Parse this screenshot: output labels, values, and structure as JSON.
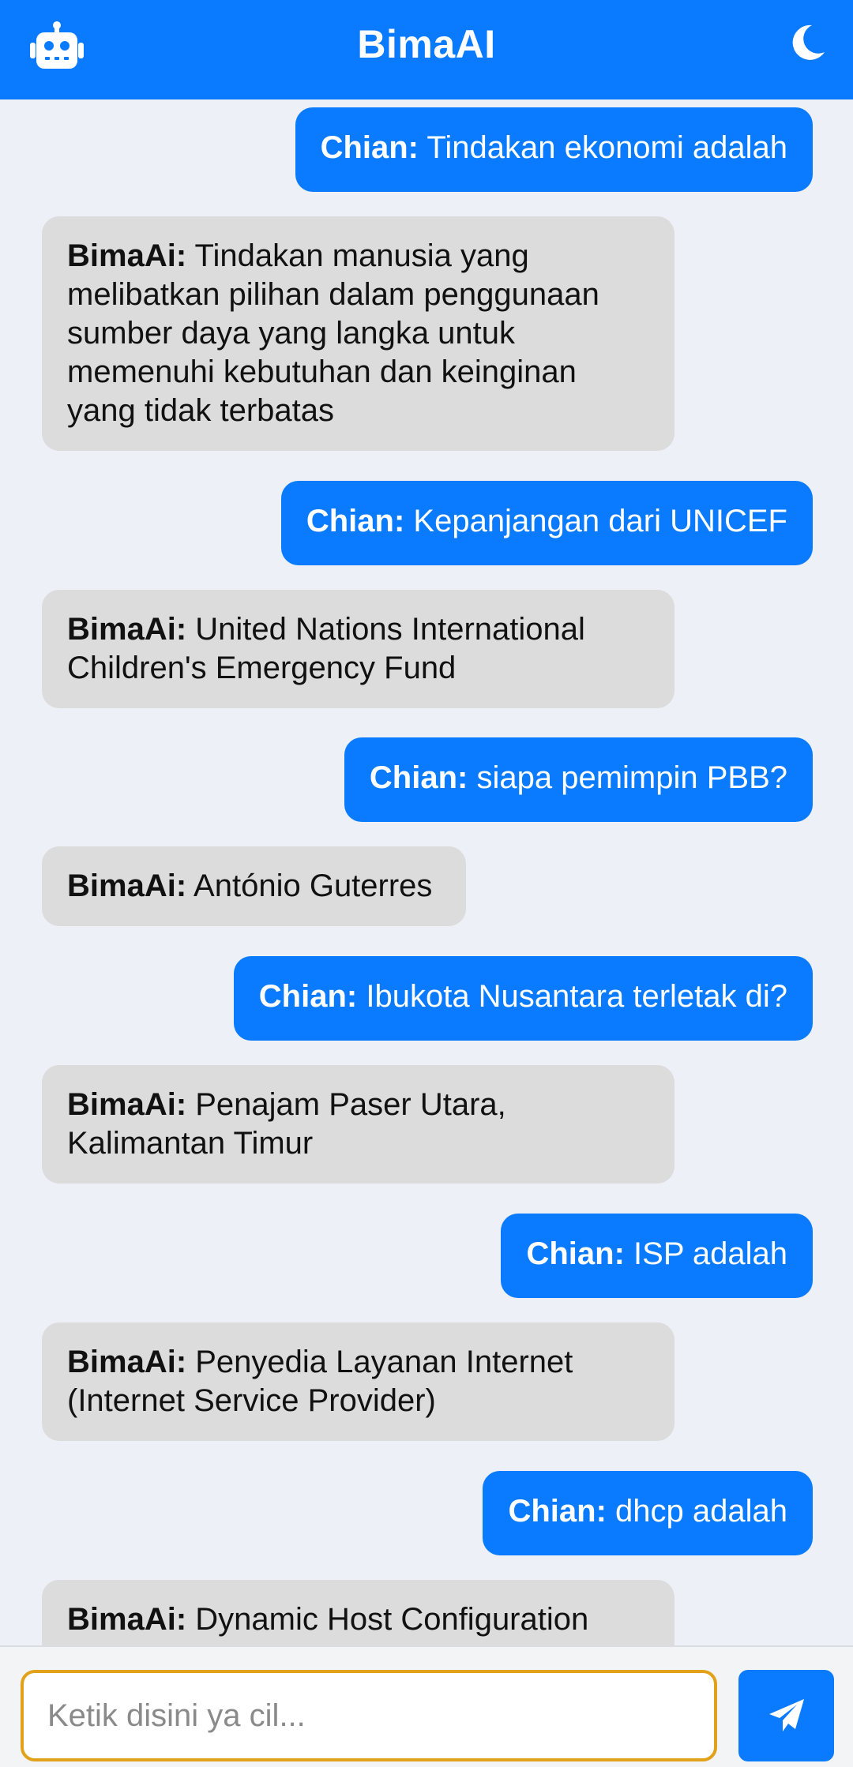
{
  "header": {
    "title": "BimaAI",
    "left_icon": "robot-icon",
    "right_icon": "moon-icon"
  },
  "messages": [
    {
      "role": "user",
      "sender": "Chian:",
      "text": " Tindakan ekonomi adalah"
    },
    {
      "role": "bot",
      "sender": "BimaAi:",
      "text": " Tindakan manusia yang melibatkan pilihan dalam penggunaan sumber daya yang langka untuk memenuhi kebutuhan dan keinginan yang tidak terbatas"
    },
    {
      "role": "user",
      "sender": "Chian:",
      "text": " Kepanjangan dari UNICEF"
    },
    {
      "role": "bot",
      "sender": "BimaAi:",
      "text": " United Nations International Children's Emergency Fund"
    },
    {
      "role": "user",
      "sender": "Chian:",
      "text": " siapa pemimpin PBB?"
    },
    {
      "role": "bot",
      "sender": "BimaAi:",
      "text": " António Guterres"
    },
    {
      "role": "user",
      "sender": "Chian:",
      "text": " Ibukota Nusantara terletak di?"
    },
    {
      "role": "bot",
      "sender": "BimaAi:",
      "text": " Penajam Paser Utara, Kalimantan Timur"
    },
    {
      "role": "user",
      "sender": "Chian:",
      "text": " ISP adalah"
    },
    {
      "role": "bot",
      "sender": "BimaAi:",
      "text": " Penyedia Layanan Internet (Internet Service Provider)"
    },
    {
      "role": "user",
      "sender": "Chian:",
      "text": " dhcp adalah"
    },
    {
      "role": "bot",
      "sender": "BimaAi:",
      "text": " Dynamic Host Configuration"
    }
  ],
  "input": {
    "placeholder": "Ketik disini ya cil...",
    "value": ""
  },
  "send_button": {
    "icon": "paper-plane-icon"
  },
  "colors": {
    "accent": "#0a7bff",
    "bot_bubble": "#dcdcdc",
    "background": "#edf1f7",
    "input_border": "#e2a11a"
  }
}
